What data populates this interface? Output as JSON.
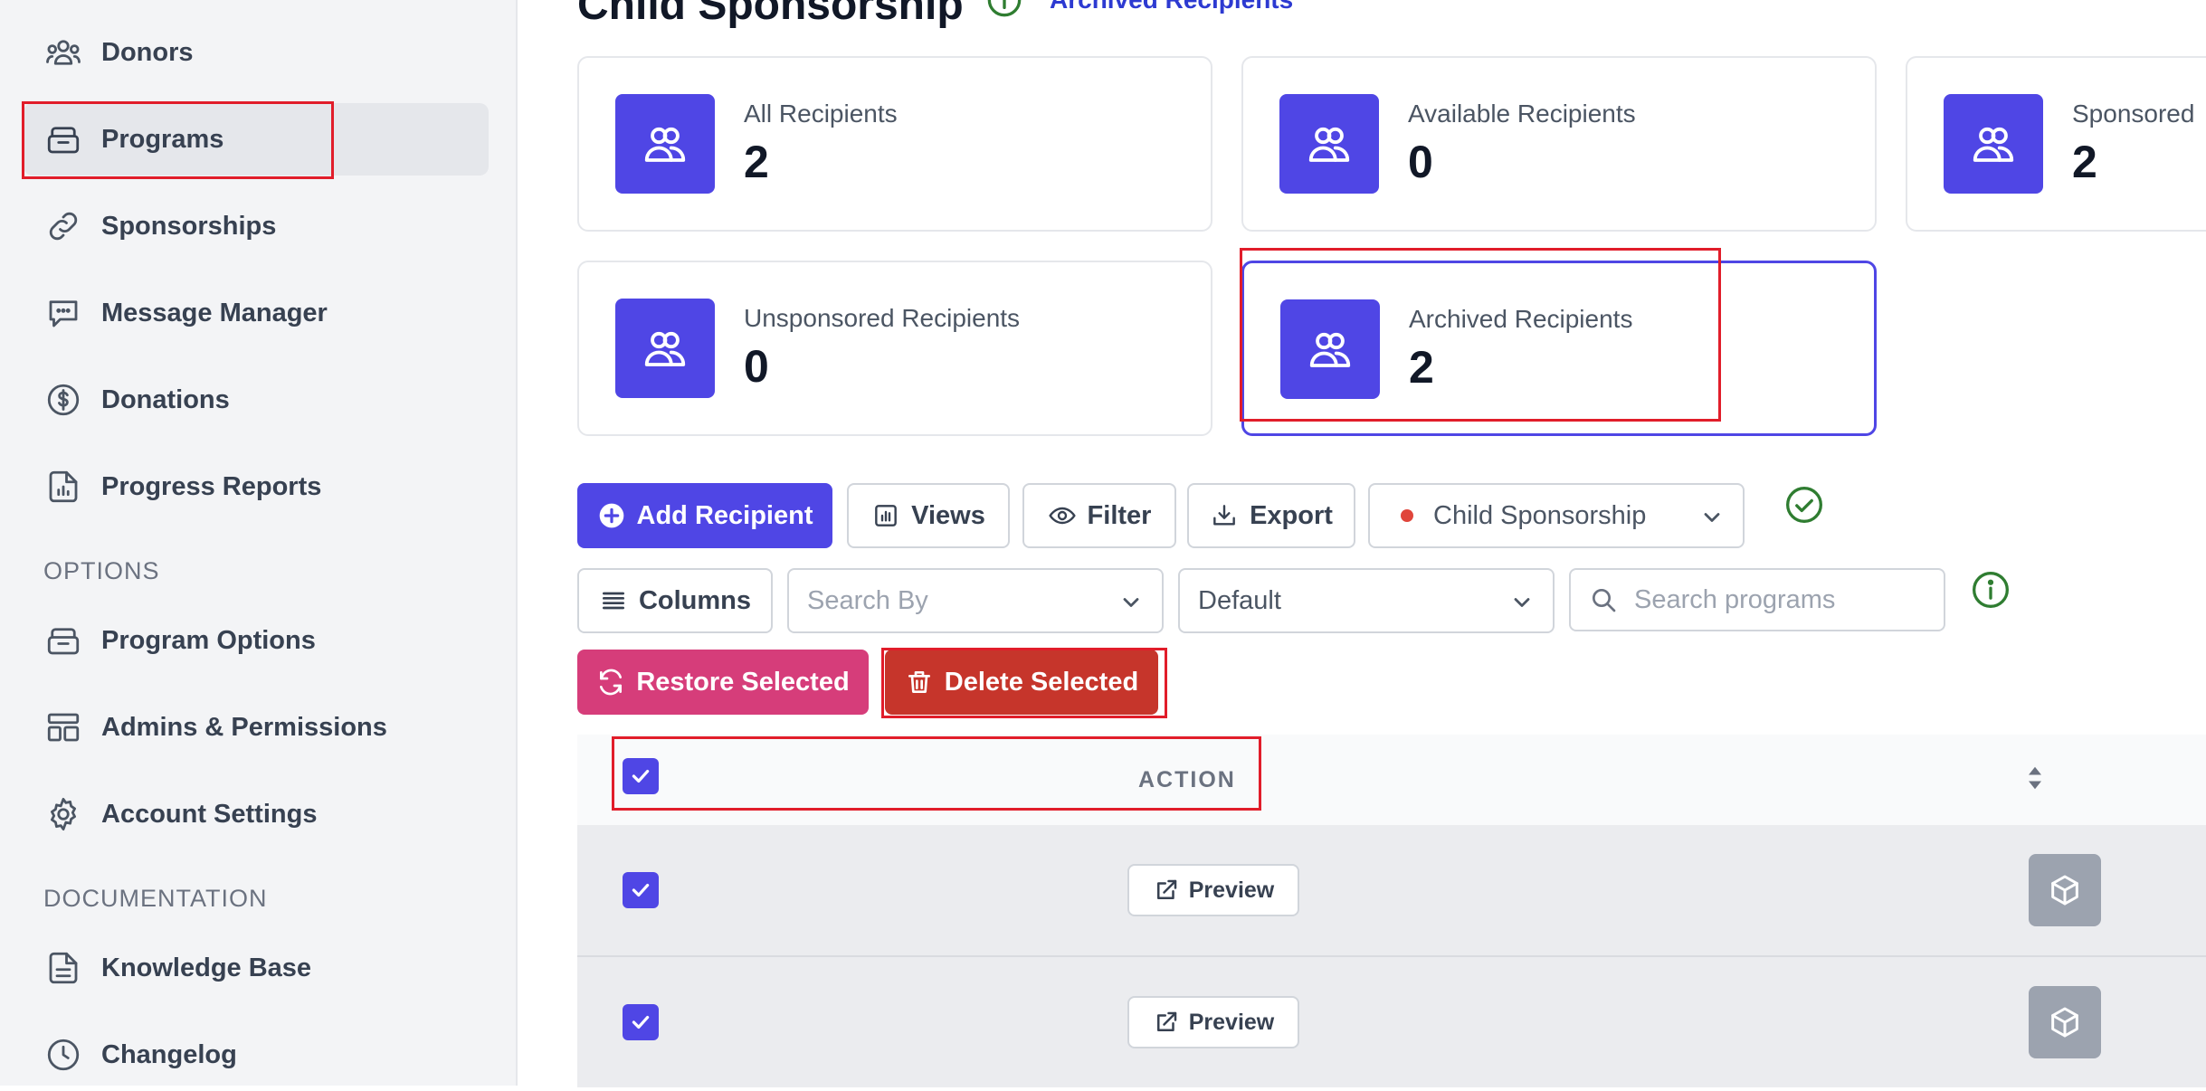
{
  "sidebar": {
    "items": [
      {
        "label": "Donors",
        "icon": "users-icon"
      },
      {
        "label": "Programs",
        "icon": "archive-icon"
      },
      {
        "label": "Sponsorships",
        "icon": "link-icon"
      },
      {
        "label": "Message Manager",
        "icon": "chat-icon"
      },
      {
        "label": "Donations",
        "icon": "dollar-icon"
      },
      {
        "label": "Progress Reports",
        "icon": "report-icon"
      }
    ],
    "options_label": "OPTIONS",
    "options_items": [
      {
        "label": "Program Options",
        "icon": "archive-icon"
      },
      {
        "label": "Admins & Permissions",
        "icon": "layout-icon"
      },
      {
        "label": "Account Settings",
        "icon": "gear-icon"
      }
    ],
    "documentation_label": "DOCUMENTATION",
    "documentation_items": [
      {
        "label": "Knowledge Base",
        "icon": "document-icon"
      },
      {
        "label": "Changelog",
        "icon": "clock-icon"
      }
    ]
  },
  "header": {
    "title": "Child Sponsorship",
    "archived_link": "Archived Recipients"
  },
  "stats": [
    {
      "label": "All Recipients",
      "value": "2"
    },
    {
      "label": "Available Recipients",
      "value": "0"
    },
    {
      "label": "Sponsored",
      "value": "2"
    },
    {
      "label": "Unsponsored Recipients",
      "value": "0"
    },
    {
      "label": "Archived Recipients",
      "value": "2"
    }
  ],
  "toolbar": {
    "add_label": "Add Recipient",
    "views_label": "Views",
    "filter_label": "Filter",
    "export_label": "Export",
    "program_select": "Child Sponsorship",
    "columns_label": "Columns",
    "search_by_placeholder": "Search By",
    "default_select": "Default",
    "search_placeholder": "Search programs",
    "restore_label": "Restore Selected",
    "delete_label": "Delete Selected"
  },
  "table": {
    "action_header": "ACTION",
    "rows": [
      {
        "preview_label": "Preview",
        "checked": true
      },
      {
        "preview_label": "Preview",
        "checked": true
      }
    ]
  },
  "colors": {
    "accent": "#4f46e5",
    "restore": "#d63d7a",
    "delete": "#c6352b",
    "status_dot": "#e0453b",
    "success": "#2f7d31",
    "highlight": "#e11d2a"
  }
}
